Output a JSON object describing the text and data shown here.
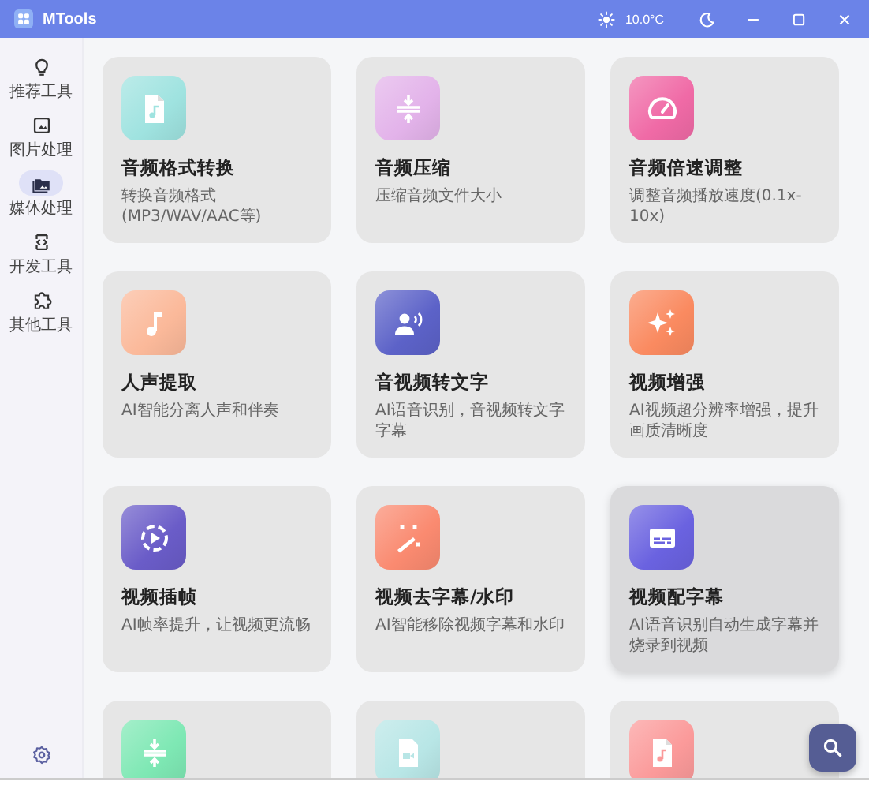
{
  "window": {
    "title": "MTools",
    "temperature": "10.0°C"
  },
  "sidebar": {
    "items": [
      {
        "label": "推荐工具",
        "kind": "bulb",
        "selected": false
      },
      {
        "label": "图片处理",
        "kind": "image",
        "selected": false
      },
      {
        "label": "媒体处理",
        "kind": "media",
        "selected": true
      },
      {
        "label": "开发工具",
        "kind": "code",
        "selected": false
      },
      {
        "label": "其他工具",
        "kind": "puzzle",
        "selected": false
      }
    ]
  },
  "cards": [
    {
      "title": "音频格式转换",
      "description": "转换音频格式(MP3/WAV/AAC等)",
      "kind": "file-music",
      "color": "#9fe3e0",
      "highlighted": false
    },
    {
      "title": "音频压缩",
      "description": "压缩音频文件大小",
      "kind": "compress",
      "color": "#e3b3ea",
      "highlighted": false
    },
    {
      "title": "音频倍速调整",
      "description": "调整音频播放速度(0.1x-10x)",
      "kind": "gauge",
      "color": "#f06aa6",
      "highlighted": false
    },
    {
      "title": "人声提取",
      "description": "AI智能分离人声和伴奏",
      "kind": "note",
      "color": "#fbb99a",
      "highlighted": false
    },
    {
      "title": "音视频转文字",
      "description": "AI语音识别，音视频转文字字幕",
      "kind": "speaker",
      "color": "#5c62c8",
      "highlighted": false
    },
    {
      "title": "视频增强",
      "description": "AI视频超分辨率增强，提升画质清晰度",
      "kind": "sparkle",
      "color": "#fa8a60",
      "highlighted": false
    },
    {
      "title": "视频插帧",
      "description": "AI帧率提升，让视频更流畅",
      "kind": "play-cycle",
      "color": "#6a5cc8",
      "highlighted": false
    },
    {
      "title": "视频去字幕/水印",
      "description": "AI智能移除视频字幕和水印",
      "kind": "wand",
      "color": "#fa8a70",
      "highlighted": false
    },
    {
      "title": "视频配字幕",
      "description": "AI语音识别自动生成字幕并烧录到视频",
      "kind": "subtitle",
      "color": "#6a62e0",
      "highlighted": true
    },
    {
      "kind": "compress",
      "color": "#7ee8b4",
      "highlighted": false
    },
    {
      "kind": "file-video",
      "color": "#b8e6e6",
      "highlighted": false
    },
    {
      "kind": "file-music",
      "color": "#fb9a9a",
      "highlighted": false
    }
  ]
}
